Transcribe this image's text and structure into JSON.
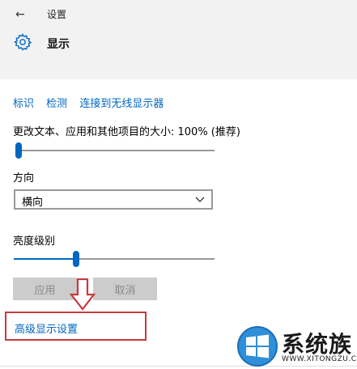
{
  "window": {
    "back_icon": "arrow-left-icon",
    "app_title": "设置"
  },
  "header": {
    "icon": "gear-icon",
    "title": "显示"
  },
  "links": [
    {
      "label": "标识"
    },
    {
      "label": "检测"
    },
    {
      "label": "连接到无线显示器"
    }
  ],
  "scale": {
    "label": "更改文本、应用和其他项目的大小: 100% (推荐)",
    "slider_value_fraction": 0.0
  },
  "orientation": {
    "label": "方向",
    "selected": "横向",
    "chevron_icon": "chevron-down-icon"
  },
  "brightness": {
    "label": "亮度级别",
    "slider_value_fraction": 0.31
  },
  "buttons": {
    "apply": "应用",
    "cancel": "取消"
  },
  "annotation": {
    "arrow_icon": "down-arrow-icon",
    "color": "#c8393f"
  },
  "advanced_link": "高级显示设置",
  "watermark": {
    "text": "系统族",
    "sub": "WWW.XITONGZU.COM"
  },
  "colors": {
    "accent": "#0067c0",
    "annotation_red": "#c8393f",
    "disabled_button": "#cccccc"
  }
}
